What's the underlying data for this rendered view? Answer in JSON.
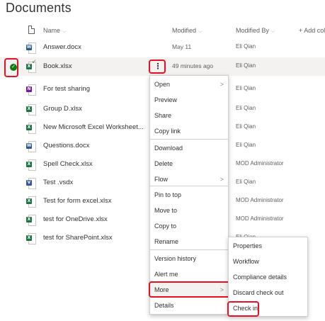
{
  "page": {
    "title": "Documents"
  },
  "columns": {
    "name": "Name",
    "modified": "Modified",
    "modified_by": "Modified By",
    "add_column": "+ Add colu",
    "chevron": "⌵"
  },
  "files": [
    {
      "name": "Answer.docx",
      "type": "word",
      "badge": "W",
      "modified": "May 11",
      "modified_by": "Eli Qian"
    },
    {
      "name": "Book.xlsx",
      "type": "excel",
      "badge": "X",
      "modified": "49 minutes ago",
      "modified_by": "Eli Qian",
      "selected": true,
      "checked_out": true
    },
    {
      "name": "For test sharing",
      "type": "one",
      "badge": "N",
      "modified": "",
      "modified_by": "Eli Qian"
    },
    {
      "name": "Group D.xlsx",
      "type": "excel",
      "badge": "X",
      "modified": "",
      "modified_by": "Eli Qian"
    },
    {
      "name": "New Microsoft Excel Worksheet...",
      "type": "excel",
      "badge": "X",
      "modified": "",
      "modified_by": "Eli Qian"
    },
    {
      "name": "Questions.docx",
      "type": "word",
      "badge": "W",
      "modified": "",
      "modified_by": "Eli Qian"
    },
    {
      "name": "Spell Check.xlsx",
      "type": "excel",
      "badge": "X",
      "modified": "",
      "modified_by": "MOD Administrator"
    },
    {
      "name": "Test .vsdx",
      "type": "visio",
      "badge": "V",
      "modified": "",
      "modified_by": "Eli Qian"
    },
    {
      "name": "Test for form excel.xlsx",
      "type": "excel",
      "badge": "X",
      "modified": "",
      "modified_by": "MOD Administrator"
    },
    {
      "name": "test for OneDrive.xlsx",
      "type": "excel",
      "badge": "X",
      "modified": "",
      "modified_by": "MOD Administrator"
    },
    {
      "name": "test for SharePoint.xlsx",
      "type": "excel",
      "badge": "X",
      "modified": "",
      "modified_by": "Eli Qian"
    }
  ],
  "row_actions": {
    "more_glyph": "⋮",
    "selected_glyph": "✓",
    "checkout_glyph": "↙"
  },
  "context_menu": {
    "groups": [
      [
        {
          "label": "Open",
          "submenu": true
        },
        {
          "label": "Preview"
        },
        {
          "label": "Share"
        },
        {
          "label": "Copy link"
        }
      ],
      [
        {
          "label": "Download"
        },
        {
          "label": "Delete"
        },
        {
          "label": "Flow",
          "submenu": true
        }
      ],
      [
        {
          "label": "Pin to top"
        },
        {
          "label": "Move to"
        },
        {
          "label": "Copy to"
        },
        {
          "label": "Rename"
        }
      ],
      [
        {
          "label": "Version history"
        },
        {
          "label": "Alert me"
        },
        {
          "label": "More",
          "submenu": true,
          "highlighted": true
        },
        {
          "label": "Details"
        }
      ]
    ],
    "arrow_glyph": ">"
  },
  "submenu": {
    "items": [
      {
        "label": "Properties"
      },
      {
        "label": "Workflow"
      },
      {
        "label": "Compliance details"
      },
      {
        "label": "Discard check out"
      },
      {
        "label": "Check in"
      }
    ]
  },
  "colors": {
    "annotation": "#e81123",
    "selected_row": "#f3f2f1",
    "checked": "#107c10"
  }
}
